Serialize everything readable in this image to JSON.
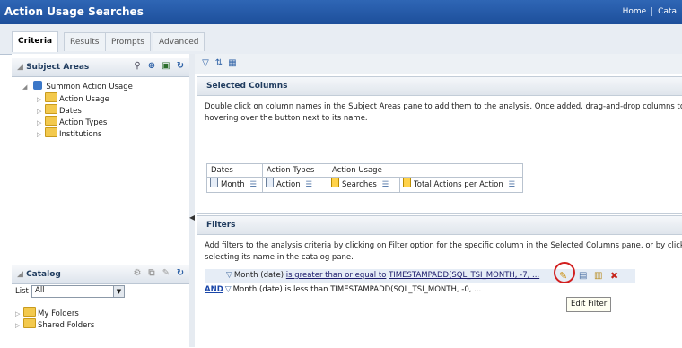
{
  "app": {
    "title": "Action Usage Searches"
  },
  "topnav": {
    "home": "Home",
    "catalog": "Cata"
  },
  "tabs": [
    {
      "label": "Criteria",
      "active": true
    },
    {
      "label": "Results"
    },
    {
      "label": "Prompts"
    },
    {
      "label": "Advanced"
    }
  ],
  "subject_areas": {
    "header": "Subject Areas",
    "root": "Summon Action Usage",
    "items": [
      "Action Usage",
      "Dates",
      "Action Types",
      "Institutions"
    ]
  },
  "catalog": {
    "header": "Catalog",
    "list_label": "List",
    "list_value": "All",
    "folders": [
      "My Folders",
      "Shared Folders"
    ]
  },
  "selected_columns": {
    "header": "Selected Columns",
    "desc_line1": "Double click on column names in the Subject Areas pane to add them to the analysis. Once added, drag-and-drop columns to re",
    "desc_line2": "hovering over the button next to its name.",
    "groups": [
      "Dates",
      "Action Types",
      "Action Usage"
    ],
    "columns": [
      "Month",
      "Action",
      "Searches",
      "Total Actions per Action"
    ]
  },
  "filters": {
    "header": "Filters",
    "desc_line1": "Add filters to the analysis criteria by clicking on Filter option for the specific column in the Selected Columns pane, or by clicking o",
    "desc_line2": "selecting its name in the catalog pane.",
    "rows": [
      {
        "column": "Month (date)",
        "operator": "is greater than or equal to",
        "value": "TIMESTAMPADD(SQL_TSI_MONTH, -7, ..."
      },
      {
        "connector": "AND",
        "column": "Month (date)",
        "operator": "is less than",
        "value": "TIMESTAMPADD(SQL_TSI_MONTH, -0, ..."
      }
    ]
  },
  "tooltip": "Edit Filter",
  "colors": {
    "titlebar": "#1d4f9b",
    "highlight_circle": "#d21f1f"
  }
}
